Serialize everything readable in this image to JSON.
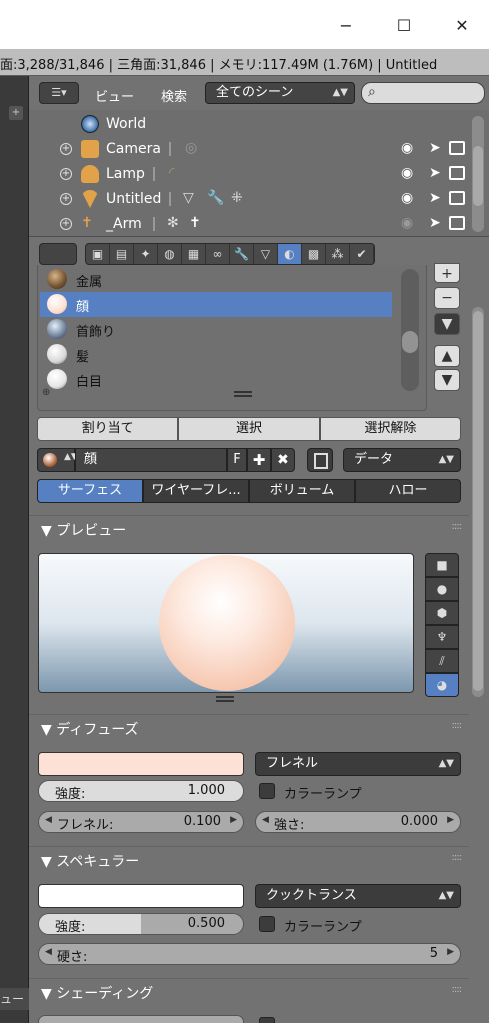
{
  "window": {
    "minimize": "−",
    "maximize": "☐",
    "close": "✕"
  },
  "info": {
    "text": "面:3,288/31,846 | 三角面:31,846 | メモリ:117.49M (1.76M) | Untitled"
  },
  "outliner": {
    "menu_view": "ビュー",
    "menu_search": "検索",
    "scene_select": "全てのシーン",
    "rows": [
      {
        "name": "World"
      },
      {
        "name": "Camera"
      },
      {
        "name": "Lamp"
      },
      {
        "name": "Untitled"
      },
      {
        "name": "_Arm"
      }
    ]
  },
  "materials": {
    "slots": [
      {
        "name": "金属",
        "color": "#7a5a36"
      },
      {
        "name": "顔",
        "color": "#fde0d2"
      },
      {
        "name": "首飾り",
        "color": "#6c7f9a"
      },
      {
        "name": "髪",
        "color": "#d8d8d8"
      },
      {
        "name": "白目",
        "color": "#e6e6e6"
      }
    ],
    "selected_index": 1,
    "assign_btn": "割り当て",
    "select_btn": "選択",
    "deselect_btn": "選択解除",
    "material_name": "顔",
    "fake_user": "F",
    "link_type": "データ",
    "tabs": [
      "サーフェス",
      "ワイヤーフレ...",
      "ボリューム",
      "ハロー"
    ],
    "active_tab": 0
  },
  "preview": {
    "title": "プレビュー"
  },
  "diffuse": {
    "title": "ディフューズ",
    "color": "#fde0d6",
    "shader": "フレネル",
    "intensity_label": "強度:",
    "intensity": "1.000",
    "intensity_fraction": 1.0,
    "ramp_label": "カラーランプ",
    "fresnel_label": "フレネル:",
    "fresnel": "0.100",
    "factor_label": "強さ:",
    "factor": "0.000"
  },
  "specular": {
    "title": "スペキュラー",
    "color": "#ffffff",
    "shader": "クックトランス",
    "intensity_label": "強度:",
    "intensity": "0.500",
    "intensity_fraction": 0.5,
    "ramp_label": "カラーランプ",
    "hardness_label": "硬さ:",
    "hardness": "5"
  },
  "shading": {
    "title": "シェーディング"
  },
  "left_strip": {
    "label": "ュー"
  },
  "colors": {
    "accent": "#5680c2",
    "panel": "#727272",
    "header_dark": "#444444"
  }
}
